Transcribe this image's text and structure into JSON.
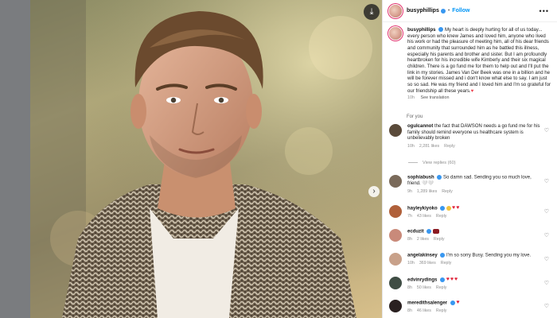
{
  "post": {
    "author": "busyphillips",
    "follow_label": "Follow",
    "caption_username": "busyphillips",
    "caption_text": "My heart is deeply hurting for all of us today... every person who knew James and loved him, anyone who lived his work or had the pleasure of meeting him, all of his dear friends and community that surrounded him as he battled this illness, especially his parents and brother and sister. But I am profoundly heartbroken for his incredible wife Kimberly and their six magical children. There is a go fund me for them to help out and I'll put the link in my stories. James Van Der Beek was one in a billion and he will be forever missed and i don't know what else to say. I am just so so sad. He was my friend and I loved him and I'm so grateful for our friendship all these years.",
    "caption_heart": "♥",
    "time": "10h",
    "see_translation": "See translation"
  },
  "section_label": "For you",
  "comments": [
    {
      "username": "ogulcannot",
      "text": "the fact that DAWSON needs a go fund me for his family should remind everyone us healthcare system is unbelievably broken",
      "time": "10h",
      "likes": "2,281 likes",
      "reply": "Reply",
      "avatar_color": "#5a4a3a"
    },
    {
      "username": "sophiabush",
      "text": "So damn sad. Sending you so much love, friend. 🤍🤍",
      "time": "9h",
      "likes": "1,289 likes",
      "reply": "Reply",
      "avatar_color": "#7a6a5a"
    },
    {
      "username": "hayleykiyoko",
      "text": "",
      "time": "7h",
      "likes": "43 likes",
      "reply": "Reply",
      "avatar_color": "#b0603a"
    },
    {
      "username": "ecduzit",
      "text": "",
      "time": "8h",
      "likes": "2 likes",
      "reply": "Reply",
      "avatar_color": "#c98a7a"
    },
    {
      "username": "angelakinsey",
      "text": "I'm so sorry Busy. Sending you my love.",
      "time": "10h",
      "likes": "369 likes",
      "reply": "Reply",
      "avatar_color": "#c8a18a"
    },
    {
      "username": "edvinrydings",
      "text": "",
      "time": "8h",
      "likes": "50 likes",
      "reply": "Reply",
      "avatar_color": "#3f4d44"
    },
    {
      "username": "meredithsalenger",
      "text": "",
      "time": "8h",
      "likes": "46 likes",
      "reply": "Reply",
      "avatar_color": "#2a2020"
    }
  ],
  "view_replies": "View replies (60)",
  "icons": {
    "download": "download-icon",
    "next": "chevron-right-icon",
    "more": "more-options-icon",
    "like": "heart-outline-icon"
  },
  "colors": {
    "follow": "#0095f6",
    "verified": "#3897f0",
    "heart": "#ed4956"
  }
}
